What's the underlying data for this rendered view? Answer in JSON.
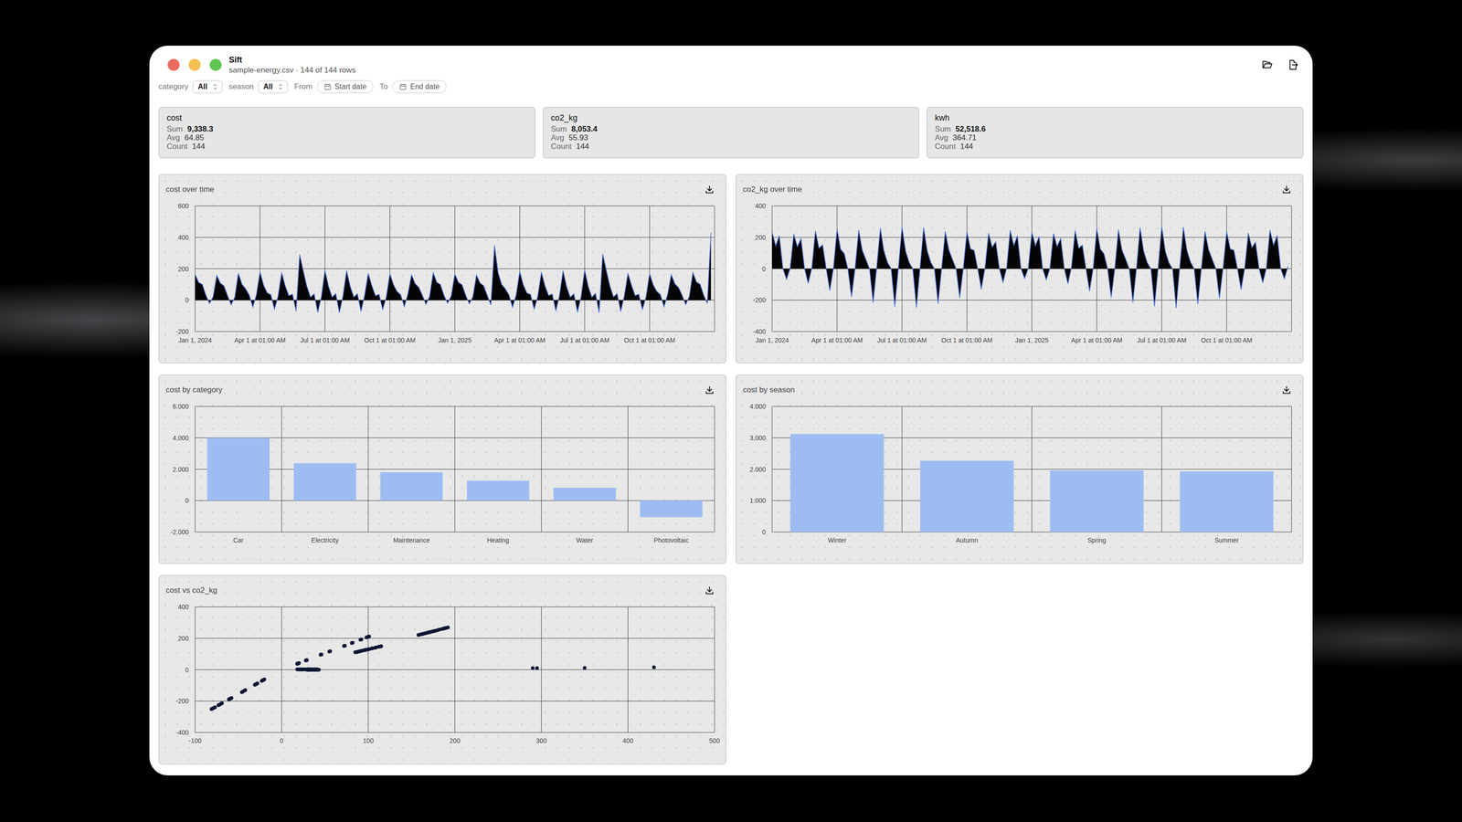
{
  "window": {
    "title": "Sift",
    "subtitle": "sample-energy.csv · 144 of 144 rows",
    "controls": [
      {
        "color": "#ed6a5e"
      },
      {
        "color": "#f5bf4f"
      },
      {
        "color": "#61c554"
      }
    ]
  },
  "filters": [
    {
      "label": "category",
      "value": "All",
      "kind": "select"
    },
    {
      "label": "season",
      "value": "All",
      "kind": "select"
    },
    {
      "label": "From",
      "value": "Start date",
      "kind": "date"
    },
    {
      "label": "To",
      "value": "End date",
      "kind": "date"
    }
  ],
  "stats": [
    {
      "title": "cost",
      "rows": [
        {
          "label": "Sum",
          "value": "9,338.3",
          "strong": true
        },
        {
          "label": "Avg",
          "value": "64.85",
          "strong": false
        },
        {
          "label": "Count",
          "value": "144",
          "strong": false
        }
      ]
    },
    {
      "title": "co2_kg",
      "rows": [
        {
          "label": "Sum",
          "value": "8,053.4",
          "strong": true
        },
        {
          "label": "Avg",
          "value": "55.93",
          "strong": false
        },
        {
          "label": "Count",
          "value": "144",
          "strong": false
        }
      ]
    },
    {
      "title": "kwh",
      "rows": [
        {
          "label": "Sum",
          "value": "52,518.6",
          "strong": true
        },
        {
          "label": "Avg",
          "value": "364.71",
          "strong": false
        },
        {
          "label": "Count",
          "value": "144",
          "strong": false
        }
      ]
    }
  ],
  "charts": [
    {
      "kind": "area",
      "title": "cost over time",
      "y_ticks": [
        "600",
        "400",
        "200",
        "0",
        "-200"
      ],
      "x_ticks": [
        "Jan 1, 2024",
        "Apr 1 at 01:00 AM",
        "Jul 1 at 01:00 AM",
        "Oct 1 at 01:00 AM",
        "Jan 1, 2025",
        "Apr 1 at 01:00 AM",
        "Jul 1 at 01:00 AM",
        "Oct 1 at 01:00 AM"
      ],
      "values": [
        165,
        112,
        100,
        31,
        -22,
        22,
        158,
        108,
        91,
        29,
        -30,
        18,
        172,
        101,
        73,
        33,
        -45,
        35,
        180,
        95,
        46,
        35,
        -58,
        24,
        176,
        90,
        28,
        38,
        -70,
        290,
        185,
        86,
        19,
        40,
        -78,
        20,
        190,
        87,
        19,
        42,
        -80,
        26,
        188,
        88,
        19,
        41,
        -72,
        31,
        170,
        92,
        28,
        37,
        -60,
        19,
        168,
        98,
        55,
        34,
        -42,
        40,
        162,
        105,
        82,
        31,
        -28,
        23,
        175,
        114,
        100,
        30,
        -20,
        27,
        166,
        113,
        98,
        32,
        -23,
        21,
        160,
        109,
        92,
        30,
        -31,
        350,
        174,
        100,
        72,
        34,
        -46,
        33,
        182,
        96,
        45,
        36,
        -59,
        25,
        178,
        91,
        29,
        39,
        -69,
        28,
        187,
        85,
        18,
        41,
        -77,
        22,
        192,
        86,
        18,
        43,
        -81,
        295,
        189,
        89,
        20,
        42,
        -73,
        30,
        171,
        93,
        29,
        38,
        -61,
        21,
        169,
        97,
        56,
        35,
        -43,
        38,
        163,
        104,
        81,
        32,
        -29,
        24,
        176,
        115,
        101,
        31,
        -21,
        430
      ]
    },
    {
      "kind": "area",
      "title": "co2_kg over time",
      "y_ticks": [
        "400",
        "200",
        "0",
        "-200",
        "-400"
      ],
      "x_ticks": [
        "Jan 1, 2024",
        "Apr 1 at 01:00 AM",
        "Jul 1 at 01:00 AM",
        "Oct 1 at 01:00 AM",
        "Jan 1, 2025",
        "Apr 1 at 01:00 AM",
        "Jul 1 at 01:00 AM",
        "Oct 1 at 01:00 AM"
      ],
      "values": [
        231,
        146,
        210,
        0,
        -68,
        2,
        221,
        140,
        191,
        0,
        -93,
        2,
        241,
        131,
        153,
        0,
        -140,
        3,
        252,
        124,
        97,
        0,
        -180,
        2,
        246,
        117,
        59,
        0,
        -217,
        10,
        259,
        112,
        40,
        0,
        -242,
        2,
        266,
        113,
        40,
        0,
        -248,
        2,
        263,
        114,
        40,
        0,
        -223,
        3,
        238,
        120,
        59,
        0,
        -186,
        2,
        235,
        127,
        116,
        0,
        -130,
        3,
        227,
        137,
        172,
        0,
        -87,
        2,
        245,
        148,
        210,
        0,
        -62,
        2,
        232,
        147,
        206,
        0,
        -71,
        2,
        224,
        142,
        193,
        0,
        -96,
        12,
        244,
        130,
        151,
        0,
        -143,
        3,
        255,
        125,
        95,
        0,
        -183,
        2,
        249,
        118,
        61,
        0,
        -214,
        2,
        262,
        111,
        38,
        0,
        -239,
        2,
        269,
        112,
        38,
        0,
        -251,
        10,
        265,
        116,
        42,
        0,
        -226,
        3,
        239,
        121,
        61,
        0,
        -189,
        2,
        237,
        126,
        118,
        0,
        -133,
        3,
        228,
        135,
        170,
        0,
        -90,
        2,
        246,
        150,
        212,
        0,
        -65,
        15
      ]
    },
    {
      "kind": "bar",
      "title": "cost by category",
      "y_ticks": [
        "6.000",
        "4.000",
        "2.000",
        "0",
        "-2.000"
      ],
      "bars": [
        {
          "label": "Car",
          "value": 4000
        },
        {
          "label": "Electricity",
          "value": 2380
        },
        {
          "label": "Maintenance",
          "value": 1800
        },
        {
          "label": "Heating",
          "value": 1270
        },
        {
          "label": "Water",
          "value": 820
        },
        {
          "label": "Photovoltaic",
          "value": -1050
        }
      ]
    },
    {
      "kind": "bar",
      "title": "cost by season",
      "y_ticks": [
        "4.000",
        "3.000",
        "2.000",
        "1.000",
        "0"
      ],
      "bars": [
        {
          "label": "Winter",
          "value": 3120
        },
        {
          "label": "Autumn",
          "value": 2270
        },
        {
          "label": "Spring",
          "value": 1960
        },
        {
          "label": "Summer",
          "value": 1930
        }
      ]
    },
    {
      "kind": "scatter",
      "title": "cost vs co2_kg",
      "y_ticks": [
        "400",
        "200",
        "0",
        "-200",
        "-400"
      ],
      "x_ticks": [
        "-100",
        "0",
        "100",
        "200",
        "300",
        "400",
        "500"
      ],
      "points": [
        [
          165,
          231
        ],
        [
          112,
          146
        ],
        [
          100,
          210
        ],
        [
          31,
          0
        ],
        [
          -22,
          -68
        ],
        [
          22,
          2
        ],
        [
          158,
          221
        ],
        [
          108,
          140
        ],
        [
          91,
          191
        ],
        [
          29,
          0
        ],
        [
          -30,
          -93
        ],
        [
          18,
          2
        ],
        [
          172,
          241
        ],
        [
          101,
          131
        ],
        [
          73,
          153
        ],
        [
          33,
          0
        ],
        [
          -45,
          -140
        ],
        [
          35,
          3
        ],
        [
          180,
          252
        ],
        [
          95,
          124
        ],
        [
          46,
          97
        ],
        [
          35,
          0
        ],
        [
          -58,
          -180
        ],
        [
          24,
          2
        ],
        [
          176,
          246
        ],
        [
          90,
          117
        ],
        [
          28,
          59
        ],
        [
          38,
          0
        ],
        [
          -70,
          -217
        ],
        [
          290,
          10
        ],
        [
          185,
          259
        ],
        [
          86,
          112
        ],
        [
          19,
          40
        ],
        [
          40,
          0
        ],
        [
          -78,
          -242
        ],
        [
          20,
          2
        ],
        [
          190,
          266
        ],
        [
          87,
          113
        ],
        [
          19,
          40
        ],
        [
          42,
          0
        ],
        [
          -80,
          -248
        ],
        [
          26,
          2
        ],
        [
          188,
          263
        ],
        [
          88,
          114
        ],
        [
          19,
          40
        ],
        [
          41,
          0
        ],
        [
          -72,
          -223
        ],
        [
          31,
          3
        ],
        [
          170,
          238
        ],
        [
          92,
          120
        ],
        [
          28,
          59
        ],
        [
          37,
          0
        ],
        [
          -60,
          -186
        ],
        [
          19,
          2
        ],
        [
          168,
          235
        ],
        [
          98,
          127
        ],
        [
          55,
          116
        ],
        [
          34,
          0
        ],
        [
          -42,
          -130
        ],
        [
          40,
          3
        ],
        [
          162,
          227
        ],
        [
          105,
          137
        ],
        [
          82,
          172
        ],
        [
          31,
          0
        ],
        [
          -28,
          -87
        ],
        [
          23,
          2
        ],
        [
          175,
          245
        ],
        [
          114,
          148
        ],
        [
          100,
          210
        ],
        [
          30,
          0
        ],
        [
          -20,
          -62
        ],
        [
          27,
          2
        ],
        [
          166,
          232
        ],
        [
          113,
          147
        ],
        [
          98,
          206
        ],
        [
          32,
          0
        ],
        [
          -23,
          -71
        ],
        [
          21,
          2
        ],
        [
          160,
          224
        ],
        [
          109,
          142
        ],
        [
          92,
          193
        ],
        [
          30,
          0
        ],
        [
          -31,
          -96
        ],
        [
          350,
          12
        ],
        [
          174,
          244
        ],
        [
          100,
          130
        ],
        [
          72,
          151
        ],
        [
          34,
          0
        ],
        [
          -46,
          -143
        ],
        [
          33,
          3
        ],
        [
          182,
          255
        ],
        [
          96,
          125
        ],
        [
          45,
          95
        ],
        [
          36,
          0
        ],
        [
          -59,
          -183
        ],
        [
          25,
          2
        ],
        [
          178,
          249
        ],
        [
          91,
          118
        ],
        [
          29,
          61
        ],
        [
          39,
          0
        ],
        [
          -69,
          -214
        ],
        [
          28,
          2
        ],
        [
          187,
          262
        ],
        [
          85,
          111
        ],
        [
          18,
          38
        ],
        [
          41,
          0
        ],
        [
          -77,
          -239
        ],
        [
          22,
          2
        ],
        [
          192,
          269
        ],
        [
          86,
          112
        ],
        [
          18,
          38
        ],
        [
          43,
          0
        ],
        [
          -81,
          -251
        ],
        [
          295,
          10
        ],
        [
          189,
          265
        ],
        [
          89,
          116
        ],
        [
          20,
          42
        ],
        [
          42,
          0
        ],
        [
          -73,
          -226
        ],
        [
          30,
          3
        ],
        [
          171,
          239
        ],
        [
          93,
          121
        ],
        [
          29,
          61
        ],
        [
          38,
          0
        ],
        [
          -61,
          -189
        ],
        [
          21,
          2
        ],
        [
          169,
          237
        ],
        [
          97,
          126
        ],
        [
          56,
          118
        ],
        [
          35,
          0
        ],
        [
          -43,
          -133
        ],
        [
          38,
          3
        ],
        [
          163,
          228
        ],
        [
          104,
          135
        ],
        [
          81,
          170
        ],
        [
          32,
          0
        ],
        [
          -29,
          -90
        ],
        [
          24,
          2
        ],
        [
          176,
          246
        ],
        [
          115,
          150
        ],
        [
          101,
          212
        ],
        [
          31,
          0
        ],
        [
          -21,
          -65
        ],
        [
          430,
          15
        ]
      ]
    }
  ]
}
